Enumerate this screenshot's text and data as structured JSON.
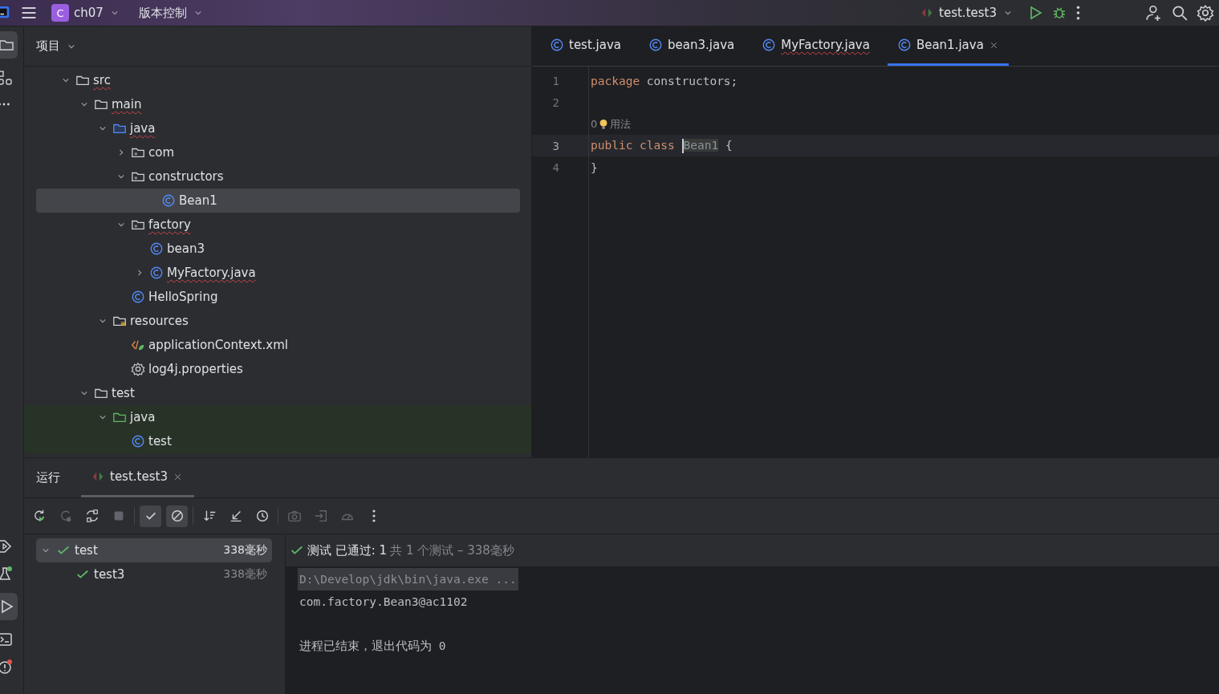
{
  "title_bar": {
    "project_badge": "C",
    "project": "ch07",
    "vcs": "版本控制",
    "run_config": "test.test3"
  },
  "project_panel": {
    "title": "项目",
    "tree": [
      {
        "label": "src",
        "kind": "folder",
        "expanded": true,
        "selected": false,
        "error": true,
        "test_scope": false,
        "children": [
          {
            "label": "main",
            "kind": "folder",
            "expanded": true,
            "selected": false,
            "error": true,
            "test_scope": false,
            "children": [
              {
                "label": "java",
                "kind": "source-folder",
                "expanded": true,
                "selected": false,
                "error": true,
                "test_scope": false,
                "children": [
                  {
                    "label": "com",
                    "kind": "package",
                    "expanded": false,
                    "selected": false,
                    "error": false,
                    "test_scope": false
                  },
                  {
                    "label": "constructors",
                    "kind": "package",
                    "expanded": true,
                    "selected": false,
                    "error": false,
                    "test_scope": false,
                    "children": [
                      {
                        "label": "Bean1",
                        "kind": "class",
                        "selected": true,
                        "error": false,
                        "test_scope": false
                      }
                    ]
                  },
                  {
                    "label": "factory",
                    "kind": "package",
                    "expanded": true,
                    "selected": false,
                    "error": true,
                    "test_scope": false,
                    "children": [
                      {
                        "label": "bean3",
                        "kind": "class",
                        "selected": false,
                        "error": false,
                        "test_scope": false
                      },
                      {
                        "label": "MyFactory.java",
                        "kind": "class",
                        "expanded": false,
                        "selected": false,
                        "error": true,
                        "test_scope": false
                      }
                    ]
                  },
                  {
                    "label": "HelloSpring",
                    "kind": "class",
                    "selected": false,
                    "error": false,
                    "test_scope": false
                  }
                ]
              },
              {
                "label": "resources",
                "kind": "resources",
                "expanded": true,
                "selected": false,
                "error": false,
                "test_scope": false,
                "children": [
                  {
                    "label": "applicationContext.xml",
                    "kind": "xml",
                    "selected": false,
                    "error": false,
                    "test_scope": false
                  },
                  {
                    "label": "log4j.properties",
                    "kind": "properties",
                    "selected": false,
                    "error": false,
                    "test_scope": false
                  }
                ]
              }
            ]
          },
          {
            "label": "test",
            "kind": "folder",
            "expanded": true,
            "selected": false,
            "error": false,
            "test_scope": false,
            "children": [
              {
                "label": "java",
                "kind": "test-folder",
                "expanded": true,
                "selected": false,
                "error": false,
                "test_scope": true,
                "children": [
                  {
                    "label": "test",
                    "kind": "class",
                    "selected": false,
                    "error": false,
                    "test_scope": true
                  }
                ]
              }
            ]
          }
        ]
      }
    ]
  },
  "editor": {
    "tabs": [
      {
        "label": "test.java",
        "selected": false,
        "error": false
      },
      {
        "label": "bean3.java",
        "selected": false,
        "error": false
      },
      {
        "label": "MyFactory.java",
        "selected": false,
        "error": true
      },
      {
        "label": "Bean1.java",
        "selected": true,
        "error": false
      }
    ],
    "lines": [
      {
        "number": "1",
        "current": false,
        "tokens": [
          {
            "text": "package",
            "keyword": true,
            "highlighted": false
          },
          {
            "text": "constructors;",
            "keyword": false,
            "highlighted": false
          }
        ]
      },
      {
        "number": "2",
        "current": false
      },
      {
        "kind": "hint",
        "count": "0",
        "text": "用法"
      },
      {
        "number": "3",
        "current": true,
        "tokens": [
          {
            "text": "public class",
            "keyword": true,
            "highlighted": false
          },
          {
            "text": "Bean1",
            "keyword": false,
            "highlighted": true
          },
          {
            "text": "{",
            "keyword": false,
            "highlighted": false
          }
        ]
      },
      {
        "number": "4",
        "current": false,
        "tokens": [
          {
            "text": "}",
            "keyword": false,
            "highlighted": false
          }
        ]
      }
    ]
  },
  "run_panel": {
    "title": "运行",
    "tabs": [
      {
        "label": "test.test3",
        "selected": true
      }
    ],
    "toolbar": [
      {
        "kind": "rerun",
        "disabled": false,
        "toggled": false
      },
      {
        "kind": "rerun-failed",
        "disabled": true,
        "toggled": false
      },
      {
        "kind": "toggle-auto",
        "disabled": false,
        "toggled": false
      },
      {
        "kind": "stop",
        "disabled": true,
        "toggled": false
      },
      {
        "kind": "sep"
      },
      {
        "kind": "show-passed",
        "disabled": false,
        "toggled": true
      },
      {
        "kind": "show-ignored",
        "disabled": false,
        "toggled": true
      },
      {
        "kind": "sep"
      },
      {
        "kind": "sort",
        "disabled": false,
        "toggled": false
      },
      {
        "kind": "import",
        "disabled": false,
        "toggled": false
      },
      {
        "kind": "history",
        "disabled": false,
        "toggled": false
      },
      {
        "kind": "sep"
      },
      {
        "kind": "camera",
        "disabled": true,
        "toggled": false
      },
      {
        "kind": "export",
        "disabled": true,
        "toggled": false
      },
      {
        "kind": "gauge",
        "disabled": true,
        "toggled": false
      },
      {
        "kind": "more",
        "disabled": false,
        "toggled": false
      }
    ],
    "tests": [
      {
        "label": "test",
        "time": "338毫秒",
        "passed": true,
        "expanded": true,
        "selected": true,
        "children": [
          {
            "label": "test3",
            "time": "338毫秒",
            "passed": true,
            "selected": false
          }
        ]
      }
    ],
    "status": {
      "passed": true,
      "text": "测试 已通过: 1",
      "detail": "共 1 个测试 – 338毫秒"
    },
    "console": [
      {
        "text": "D:\\Develop\\jdk\\bin\\java.exe ...",
        "kind": "command"
      },
      {
        "text": "com.factory.Bean3@ac1102",
        "kind": "output"
      },
      {
        "text": "进程已结束，退出代码为 0",
        "kind": "gap-output"
      }
    ]
  }
}
